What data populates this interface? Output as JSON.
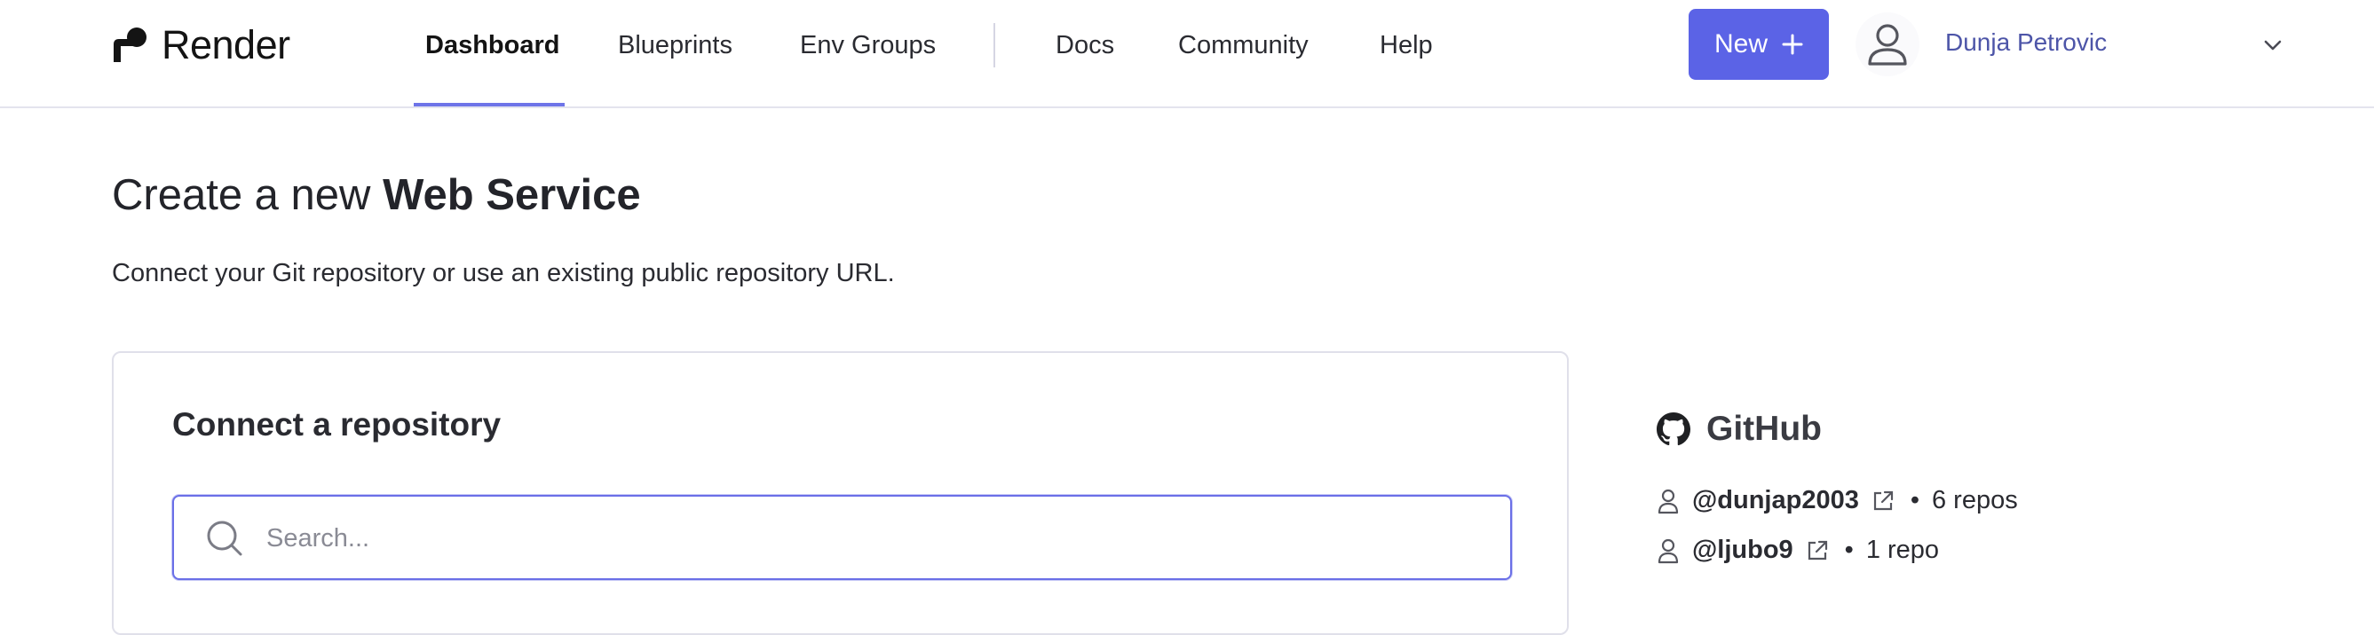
{
  "brand": {
    "name": "Render"
  },
  "nav": {
    "items": [
      {
        "label": "Dashboard",
        "active": true
      },
      {
        "label": "Blueprints"
      },
      {
        "label": "Env Groups"
      },
      {
        "label": "Docs"
      },
      {
        "label": "Community"
      },
      {
        "label": "Help"
      }
    ]
  },
  "header": {
    "new_button_label": "New",
    "new_button_icon": "plus-icon",
    "user_name": "Dunja Petrovic",
    "user_icon": "user-icon",
    "menu_icon": "chevron-down-icon"
  },
  "page": {
    "title_prefix": "Create a new",
    "title_emphasis": "Web Service",
    "subtitle": "Connect your Git repository or use an existing public repository URL."
  },
  "repo_card": {
    "title": "Connect a repository",
    "search_placeholder": "Search..."
  },
  "github": {
    "title": "GitHub",
    "icon": "github-icon",
    "accounts": [
      {
        "handle": "@dunjap2003",
        "repos": "6 repos"
      },
      {
        "handle": "@ljubo9",
        "repos": "1 repo"
      }
    ]
  },
  "colors": {
    "accent": "#5b63e6",
    "nav_underline": "#6e74e8",
    "user_name": "#4d55a8",
    "search_border": "#6a6fe7"
  }
}
